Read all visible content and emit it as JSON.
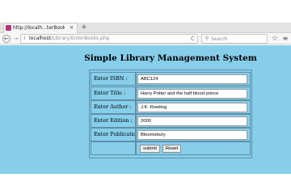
{
  "browser": {
    "tab": {
      "title": "http://localh...terBooks.php",
      "close": "×"
    },
    "new_tab": "+",
    "nav": {
      "back": "←",
      "forward": "→",
      "reload": "C"
    },
    "url": {
      "host": "localhost",
      "path": "/Library/EnterBooks.php"
    },
    "search": {
      "placeholder": "Search"
    },
    "icons": {
      "info": "i",
      "search": "⚲",
      "star": "☆",
      "menu": "≡"
    }
  },
  "page": {
    "title": "Simple Library Management System",
    "background_color": "#87ceeb",
    "form": {
      "fields": [
        {
          "label": "Enter ISBN :",
          "value": "ABC124"
        },
        {
          "label": "Enter Title :",
          "value": "Harry Potter and the half blood prince"
        },
        {
          "label": "Enter Author :",
          "value": "J.K. Rowling"
        },
        {
          "label": "Enter Edition :",
          "value": "2000"
        },
        {
          "label": "Enter Publication:",
          "value": "Bloomsbury"
        }
      ],
      "submit_label": "submit",
      "reset_label": "Reset"
    }
  }
}
